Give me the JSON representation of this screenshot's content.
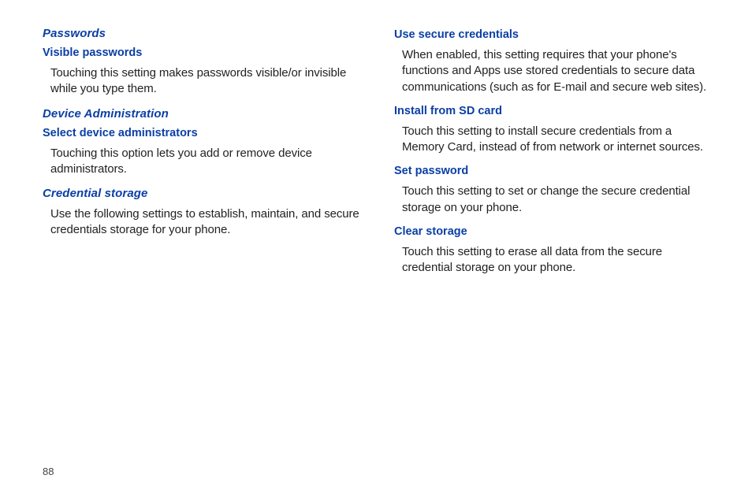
{
  "page_number": "88",
  "left": {
    "section1": {
      "heading": "Passwords",
      "sub1": {
        "heading": "Visible passwords",
        "body": "Touching this setting makes passwords visible/or invisible while you type them."
      }
    },
    "section2": {
      "heading": "Device Administration",
      "sub1": {
        "heading": "Select device administrators",
        "body": "Touching this option lets you add or remove device administrators."
      }
    },
    "section3": {
      "heading": "Credential storage",
      "body": "Use the following settings to establish, maintain, and secure credentials storage for your phone."
    }
  },
  "right": {
    "sub1": {
      "heading": "Use secure credentials",
      "body": "When enabled, this setting requires that your phone's functions and Apps use stored credentials to secure data communications (such as for E-mail and secure web sites)."
    },
    "sub2": {
      "heading": "Install from SD card",
      "body": "Touch this setting to install secure credentials from a Memory Card, instead of from network or internet sources."
    },
    "sub3": {
      "heading": "Set password",
      "body": "Touch this setting to set or change the secure credential storage on your phone."
    },
    "sub4": {
      "heading": "Clear storage",
      "body": "Touch this setting to erase all data from the secure credential storage on your phone."
    }
  }
}
